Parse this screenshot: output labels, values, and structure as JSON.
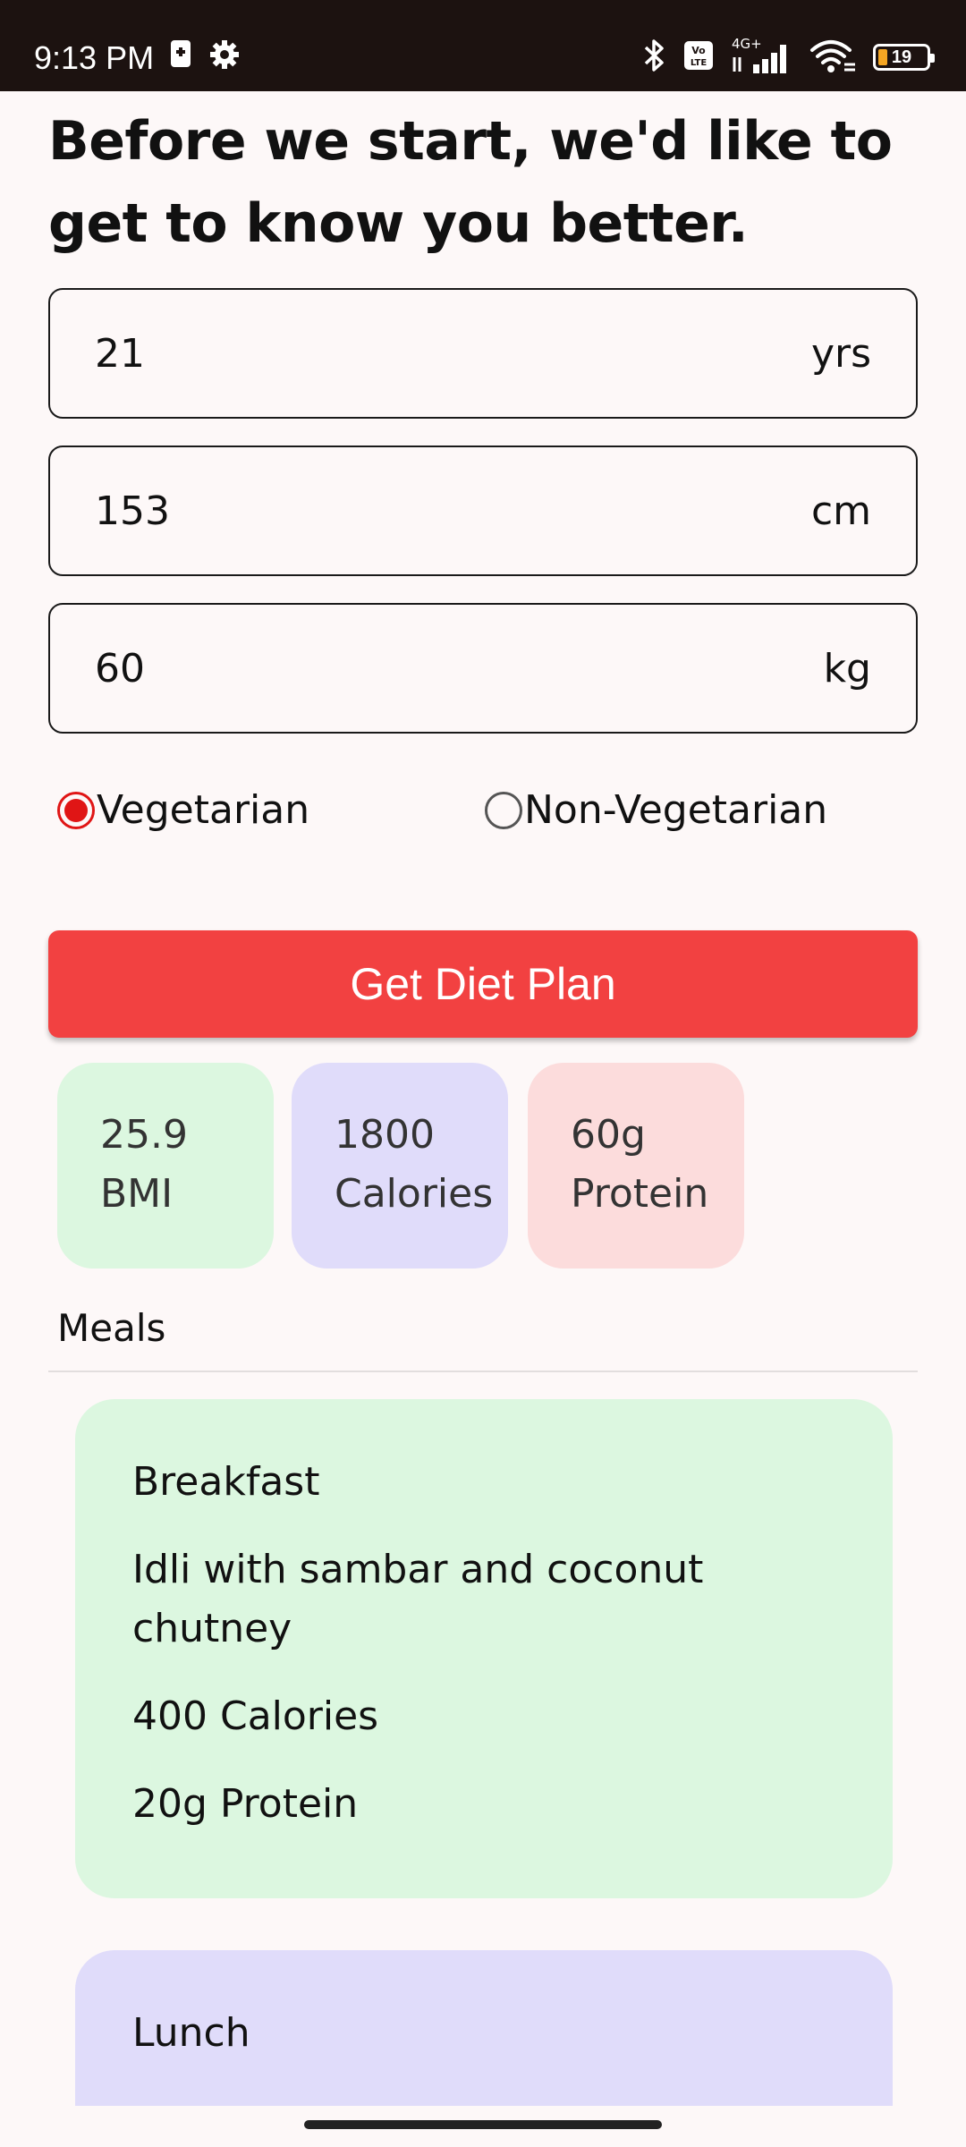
{
  "status_bar": {
    "time": "9:13 PM",
    "battery": "19",
    "icons": [
      "sim-icon",
      "settings-icon",
      "bluetooth-icon",
      "volte-icon",
      "signal-icon",
      "wifi-icon",
      "battery-icon"
    ]
  },
  "heading": "Before we start, we'd like to get to know you better.",
  "fields": {
    "age": {
      "value": "21",
      "unit": "yrs"
    },
    "height": {
      "value": "153",
      "unit": "cm"
    },
    "weight": {
      "value": "60",
      "unit": "kg"
    }
  },
  "diet": {
    "options": [
      "Vegetarian",
      "Non-Vegetarian"
    ],
    "selected": "Vegetarian"
  },
  "cta_label": "Get Diet Plan",
  "stats": [
    {
      "value": "25.9",
      "label": "BMI",
      "color": "#dcf7e0"
    },
    {
      "value": "1800",
      "label": "Calories",
      "color": "#e0dcfa"
    },
    {
      "value": "60g",
      "label": "Protein",
      "color": "#fcdcdc"
    }
  ],
  "meals_label": "Meals",
  "meals": [
    {
      "name": "Breakfast",
      "description": "Idli with sambar and coconut chutney",
      "calories": "400 Calories",
      "protein": "20g Protein",
      "color": "#dcf7e0"
    },
    {
      "name": "Lunch",
      "color": "#e0dcfa"
    }
  ],
  "colors": {
    "accent": "#f24141",
    "radio_selected": "#e01515",
    "status_bar": "#1c1210",
    "background": "#fdf8f8"
  }
}
